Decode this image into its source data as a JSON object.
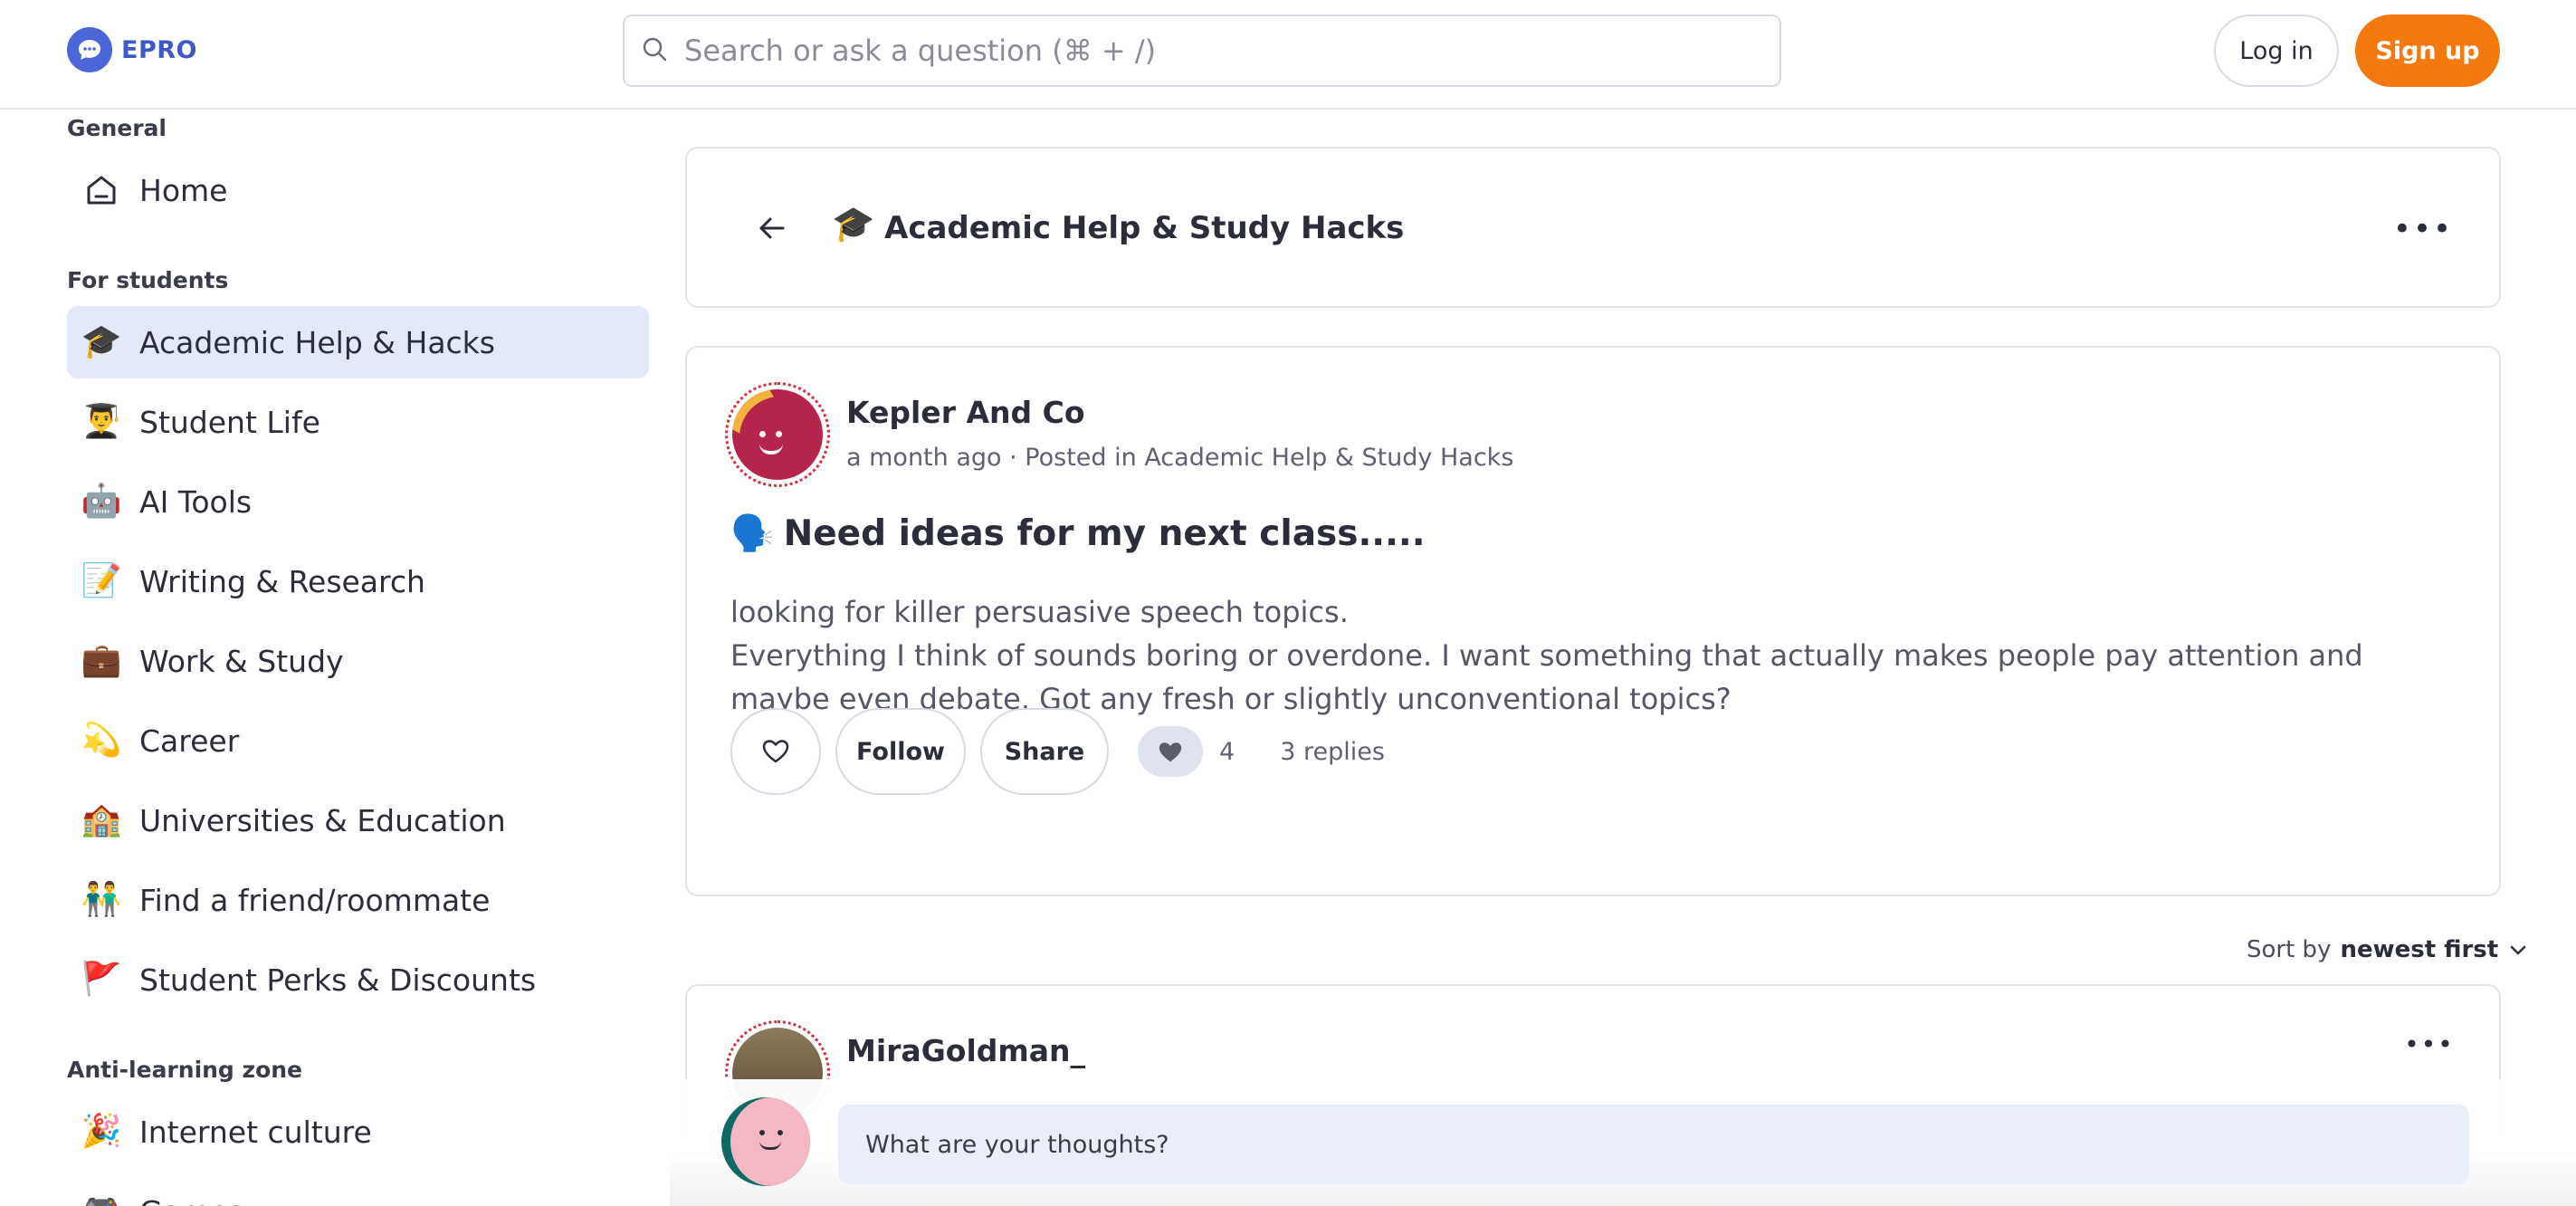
{
  "header": {
    "logo_text": "EPRO",
    "search_placeholder": "Search or ask a question (⌘ + /)",
    "login_label": "Log in",
    "signup_label": "Sign up",
    "brand_color": "#4b66d6",
    "accent_color": "#f47a10"
  },
  "sidebar": {
    "sections": [
      {
        "label": "General"
      },
      {
        "label": "For students"
      },
      {
        "label": "Anti-learning zone"
      }
    ],
    "items": [
      {
        "label": "Home",
        "icon": "home-icon"
      },
      {
        "label": "Academic Help & Hacks",
        "icon": "graduation-cap-icon",
        "active": true
      },
      {
        "label": "Student Life",
        "icon": "student-icon"
      },
      {
        "label": "AI Tools",
        "icon": "robot-icon"
      },
      {
        "label": "Writing & Research",
        "icon": "memo-icon"
      },
      {
        "label": "Work & Study",
        "icon": "briefcase-icon"
      },
      {
        "label": "Career",
        "icon": "dizzy-icon"
      },
      {
        "label": "Universities & Education",
        "icon": "school-icon"
      },
      {
        "label": "Find a friend/roommate",
        "icon": "two-people-icon"
      },
      {
        "label": "Student Perks & Discounts",
        "icon": "flag-icon"
      },
      {
        "label": "Internet culture",
        "icon": "party-popper-icon"
      },
      {
        "label": "Games",
        "icon": "game-controller-icon"
      }
    ]
  },
  "category": {
    "emoji": "🎓",
    "title": "Academic Help & Study Hacks"
  },
  "post": {
    "author": "Kepler And Co",
    "meta": "a month ago · Posted in Academic Help & Study Hacks",
    "title_emoji": "🗣️",
    "title": "Need ideas for my next class.....",
    "body_line1": "looking for killer persuasive speech topics.",
    "body_line2": "Everything I think of sounds boring or overdone. I want something that actually makes people pay attention and maybe even debate. Got any fresh or slightly unconventional topics?",
    "follow_label": "Follow",
    "share_label": "Share",
    "reaction_count": "4",
    "replies_label": "3 replies"
  },
  "sort": {
    "prefix": "Sort by",
    "value": "newest first"
  },
  "reply": {
    "author": "MiraGoldman_"
  },
  "composer": {
    "placeholder": "What are your thoughts?"
  }
}
